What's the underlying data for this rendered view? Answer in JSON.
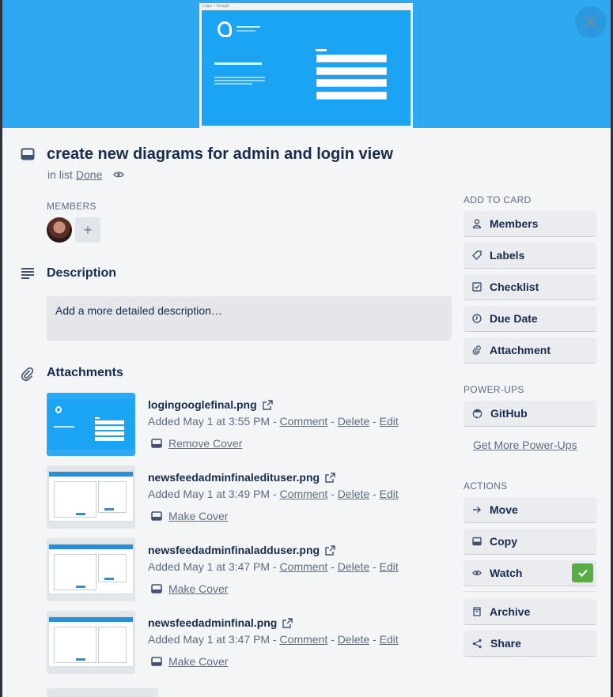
{
  "cover": {
    "tab_title": "Login – Google"
  },
  "card": {
    "title": "create new diagrams for admin and login view",
    "in_list_prefix": "in list",
    "list_name": "Done"
  },
  "members": {
    "label": "MEMBERS",
    "add_symbol": "+"
  },
  "description": {
    "title": "Description",
    "placeholder": "Add a more detailed description…"
  },
  "attachments": {
    "title": "Attachments",
    "items": [
      {
        "name": "logingooglefinal.png",
        "added": "Added May 1 at 3:55 PM",
        "comment": "Comment",
        "delete": "Delete",
        "edit": "Edit",
        "cover_action": "Remove Cover",
        "sep": "-"
      },
      {
        "name": "newsfeedadminfinaledituser.png",
        "added": "Added May 1 at 3:49 PM",
        "comment": "Comment",
        "delete": "Delete",
        "edit": "Edit",
        "cover_action": "Make Cover",
        "sep": "-"
      },
      {
        "name": "newsfeedadminfinaladduser.png",
        "added": "Added May 1 at 3:47 PM",
        "comment": "Comment",
        "delete": "Delete",
        "edit": "Edit",
        "cover_action": "Make Cover",
        "sep": "-"
      },
      {
        "name": "newsfeedadminfinal.png",
        "added": "Added May 1 at 3:47 PM",
        "comment": "Comment",
        "delete": "Delete",
        "edit": "Edit",
        "cover_action": "Make Cover",
        "sep": "-"
      }
    ]
  },
  "sidebar": {
    "add_to_card_label": "ADD TO CARD",
    "add_to_card": [
      {
        "label": "Members",
        "icon": "person-icon"
      },
      {
        "label": "Labels",
        "icon": "tag-icon"
      },
      {
        "label": "Checklist",
        "icon": "checkbox-icon"
      },
      {
        "label": "Due Date",
        "icon": "clock-icon"
      },
      {
        "label": "Attachment",
        "icon": "paperclip-icon"
      }
    ],
    "powerups_label": "POWER-UPS",
    "powerups": [
      {
        "label": "GitHub",
        "icon": "github-icon"
      }
    ],
    "get_more_powerups": "Get More Power-Ups",
    "actions_label": "ACTIONS",
    "actions": [
      {
        "label": "Move",
        "icon": "arrow-right-icon"
      },
      {
        "label": "Copy",
        "icon": "card-icon"
      },
      {
        "label": "Watch",
        "icon": "eye-icon",
        "checked": true
      },
      {
        "label": "Archive",
        "icon": "archive-icon"
      },
      {
        "label": "Share",
        "icon": "share-icon"
      }
    ]
  },
  "colors": {
    "cover_bg": "#2ea8f0",
    "watch_check": "#5aac44"
  }
}
